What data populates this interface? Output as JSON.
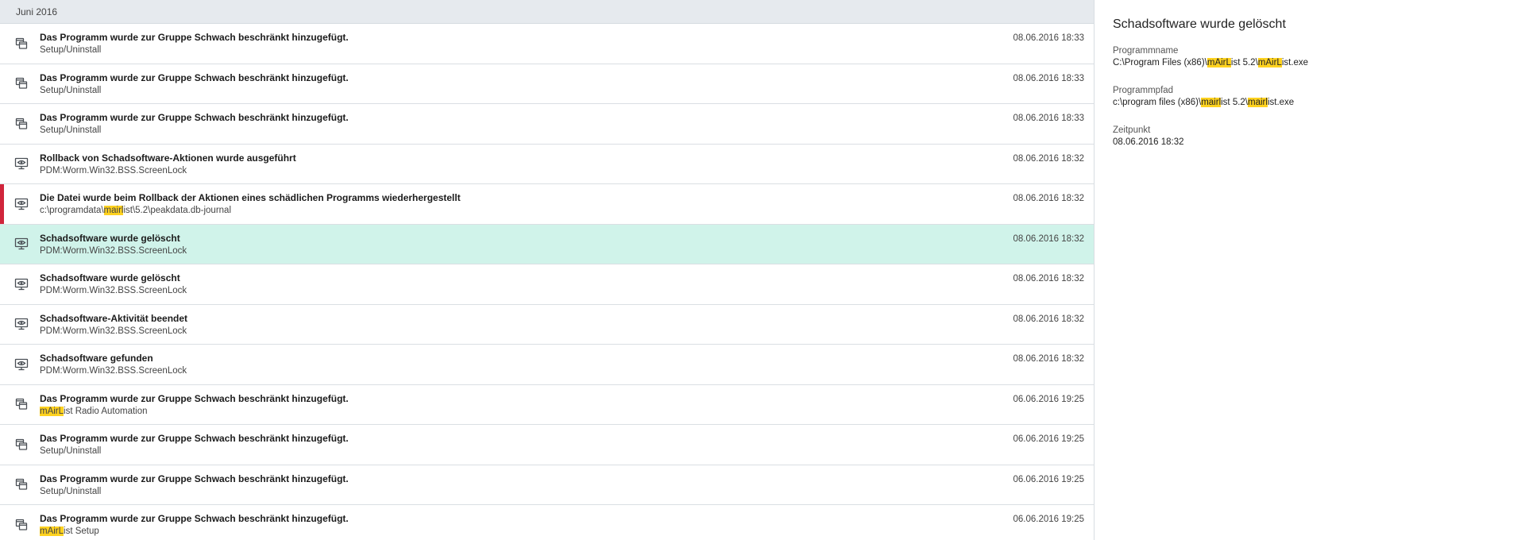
{
  "group": {
    "label": "Juni 2016"
  },
  "events": [
    {
      "icon": "program-window-icon",
      "title": "Das Programm wurde zur Gruppe Schwach beschränkt hinzugefügt.",
      "sub_parts": [
        {
          "t": "Setup/Uninstall"
        }
      ],
      "time": "08.06.2016 18:33",
      "selected": false,
      "marker": false
    },
    {
      "icon": "program-window-icon",
      "title": "Das Programm wurde zur Gruppe Schwach beschränkt hinzugefügt.",
      "sub_parts": [
        {
          "t": "Setup/Uninstall"
        }
      ],
      "time": "08.06.2016 18:33",
      "selected": false,
      "marker": false
    },
    {
      "icon": "program-window-icon",
      "title": "Das Programm wurde zur Gruppe Schwach beschränkt hinzugefügt.",
      "sub_parts": [
        {
          "t": "Setup/Uninstall"
        }
      ],
      "time": "08.06.2016 18:33",
      "selected": false,
      "marker": false
    },
    {
      "icon": "monitor-eye-icon",
      "title": "Rollback von Schadsoftware-Aktionen wurde ausgeführt",
      "sub_parts": [
        {
          "t": "PDM:Worm.Win32.BSS.ScreenLock"
        }
      ],
      "time": "08.06.2016 18:32",
      "selected": false,
      "marker": false
    },
    {
      "icon": "monitor-eye-icon",
      "title": "Die Datei wurde beim Rollback der Aktionen eines schädlichen Programms wiederhergestellt",
      "sub_parts": [
        {
          "t": "c:\\programdata\\"
        },
        {
          "t": "mairl",
          "hl": true
        },
        {
          "t": "ist\\5.2\\peakdata.db-journal"
        }
      ],
      "time": "08.06.2016 18:32",
      "selected": false,
      "marker": true
    },
    {
      "icon": "monitor-eye-icon",
      "title": "Schadsoftware wurde gelöscht",
      "sub_parts": [
        {
          "t": "PDM:Worm.Win32.BSS.ScreenLock"
        }
      ],
      "time": "08.06.2016 18:32",
      "selected": true,
      "marker": false
    },
    {
      "icon": "monitor-eye-icon",
      "title": "Schadsoftware wurde gelöscht",
      "sub_parts": [
        {
          "t": "PDM:Worm.Win32.BSS.ScreenLock"
        }
      ],
      "time": "08.06.2016 18:32",
      "selected": false,
      "marker": false
    },
    {
      "icon": "monitor-eye-icon",
      "title": "Schadsoftware-Aktivität beendet",
      "sub_parts": [
        {
          "t": "PDM:Worm.Win32.BSS.ScreenLock"
        }
      ],
      "time": "08.06.2016 18:32",
      "selected": false,
      "marker": false
    },
    {
      "icon": "monitor-eye-icon",
      "title": "Schadsoftware gefunden",
      "sub_parts": [
        {
          "t": "PDM:Worm.Win32.BSS.ScreenLock"
        }
      ],
      "time": "08.06.2016 18:32",
      "selected": false,
      "marker": false
    },
    {
      "icon": "program-window-icon",
      "title": "Das Programm wurde zur Gruppe Schwach beschränkt hinzugefügt.",
      "sub_parts": [
        {
          "t": "mAirL",
          "hl": true
        },
        {
          "t": "ist Radio Automation"
        }
      ],
      "time": "06.06.2016 19:25",
      "selected": false,
      "marker": false
    },
    {
      "icon": "program-window-icon",
      "title": "Das Programm wurde zur Gruppe Schwach beschränkt hinzugefügt.",
      "sub_parts": [
        {
          "t": "Setup/Uninstall"
        }
      ],
      "time": "06.06.2016 19:25",
      "selected": false,
      "marker": false
    },
    {
      "icon": "program-window-icon",
      "title": "Das Programm wurde zur Gruppe Schwach beschränkt hinzugefügt.",
      "sub_parts": [
        {
          "t": "Setup/Uninstall"
        }
      ],
      "time": "06.06.2016 19:25",
      "selected": false,
      "marker": false
    },
    {
      "icon": "program-window-icon",
      "title": "Das Programm wurde zur Gruppe Schwach beschränkt hinzugefügt.",
      "sub_parts": [
        {
          "t": "mAirL",
          "hl": true
        },
        {
          "t": "ist Setup"
        }
      ],
      "time": "06.06.2016 19:25",
      "selected": false,
      "marker": false
    }
  ],
  "detail": {
    "title": "Schadsoftware wurde gelöscht",
    "fields": [
      {
        "label": "Programmname",
        "parts": [
          {
            "t": "C:\\Program Files (x86)\\"
          },
          {
            "t": "mAirL",
            "hl": true
          },
          {
            "t": "ist 5.2\\"
          },
          {
            "t": "mAirL",
            "hl": true
          },
          {
            "t": "ist.exe"
          }
        ]
      },
      {
        "label": "Programmpfad",
        "parts": [
          {
            "t": "c:\\program files (x86)\\"
          },
          {
            "t": "mairl",
            "hl": true
          },
          {
            "t": "ist 5.2\\"
          },
          {
            "t": "mairl",
            "hl": true
          },
          {
            "t": "ist.exe"
          }
        ]
      },
      {
        "label": "Zeitpunkt",
        "parts": [
          {
            "t": "08.06.2016 18:32"
          }
        ]
      }
    ]
  },
  "colors": {
    "selected_row": "#d0f3ea",
    "highlight": "#ffd21f",
    "alert_marker": "#d0253b",
    "group_header": "#e6eaee"
  }
}
